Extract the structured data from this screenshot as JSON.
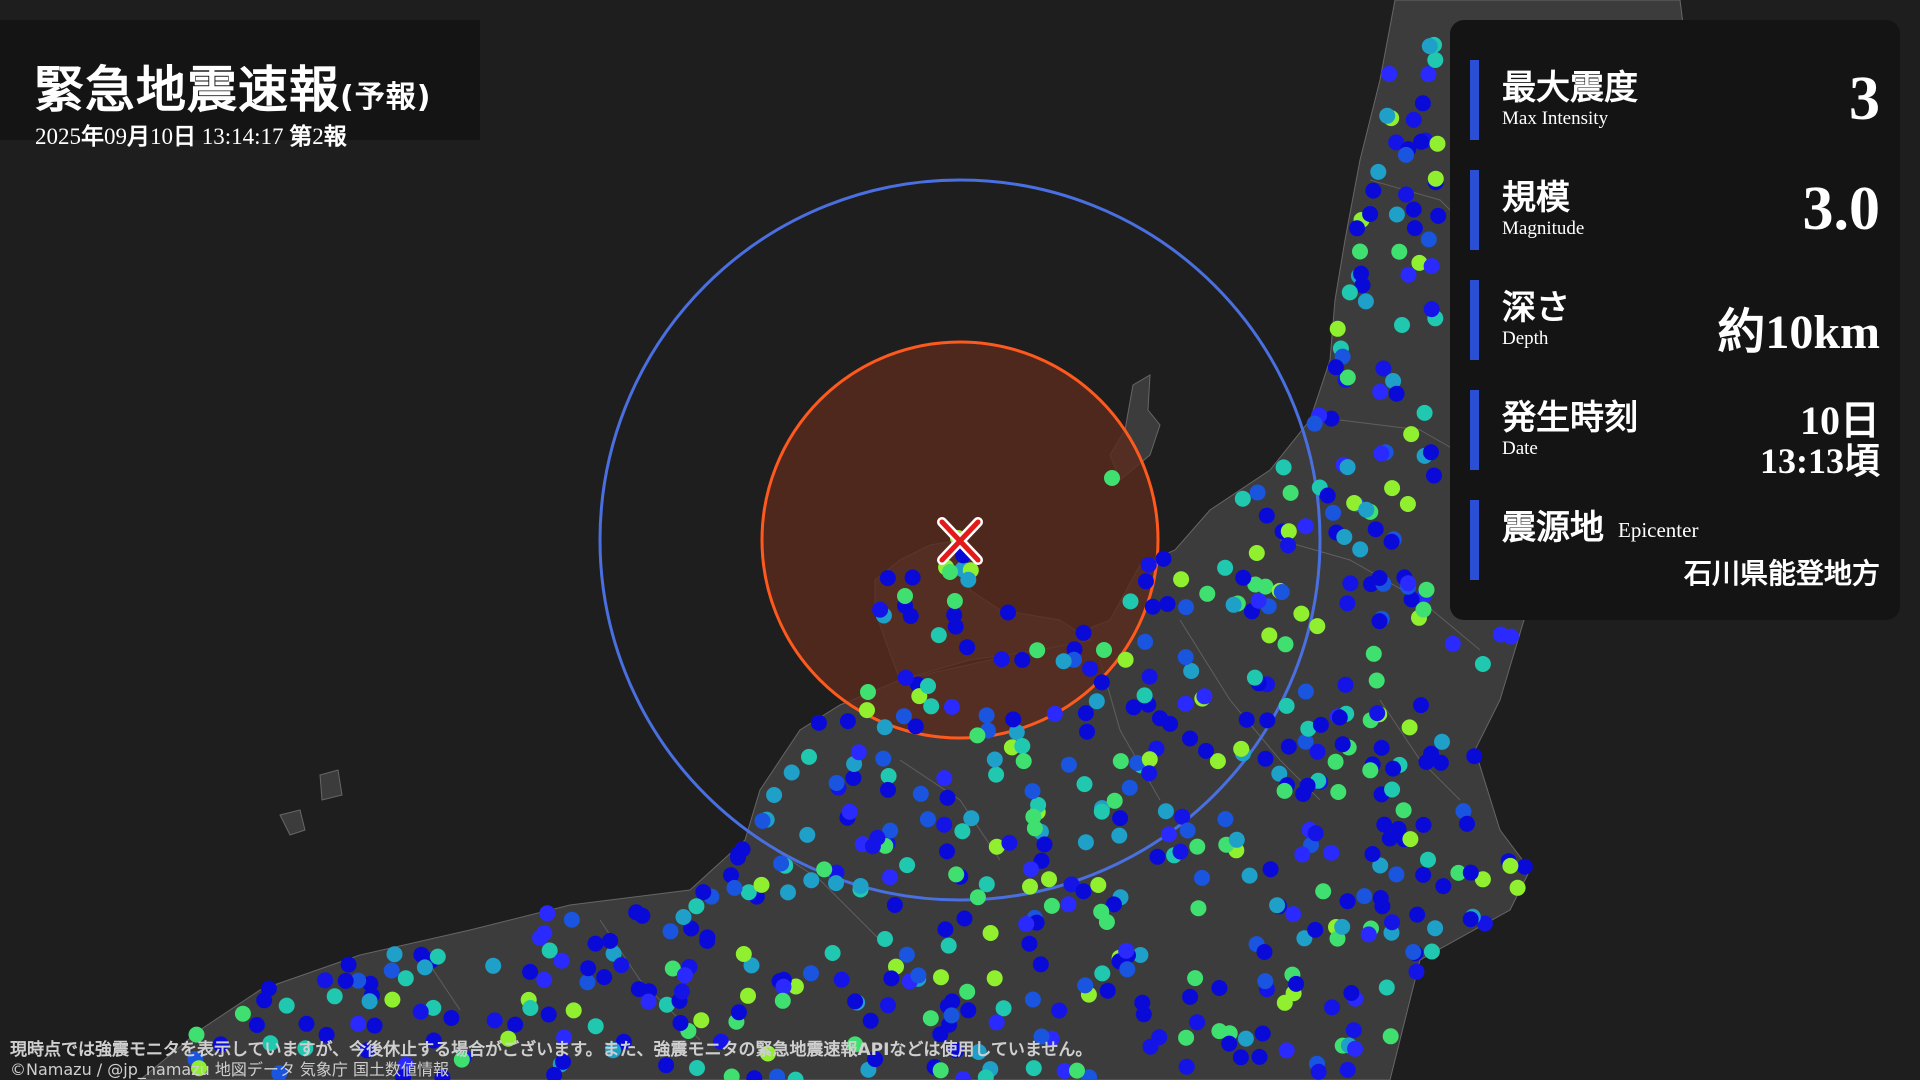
{
  "header": {
    "title": "緊急地震速報",
    "title_sub": "(予報)",
    "date_prefix": "2025",
    "date_year_char": "年",
    "date_month": "09",
    "date_month_char": "月",
    "date_day": "10",
    "date_day_char": "日",
    "time": "13:14:17",
    "report_prefix": "第",
    "report_number": "2",
    "report_suffix": "報"
  },
  "info": {
    "max_intensity": {
      "label": "最大震度",
      "label_en": "Max Intensity",
      "value": "3"
    },
    "magnitude": {
      "label": "規模",
      "label_en": "Magnitude",
      "value": "3.0"
    },
    "depth": {
      "label": "深さ",
      "label_en": "Depth",
      "value": "約10km"
    },
    "date": {
      "label": "発生時刻",
      "label_en": "Date",
      "day": "10日",
      "time": "13:13頃"
    },
    "epicenter": {
      "label": "震源地",
      "label_en": "Epicenter",
      "value": "石川県能登地方"
    }
  },
  "footer": {
    "notice": "現時点では強震モニタを表示していますが、今後休止する場合がございます。また、強震モニタの緊急地震速報APIなどは使用していません。",
    "credit": "©Namazu / @jp_namazu   地図データ 気象庁 国土数値情報"
  },
  "colors": {
    "background": "#1e1e1e",
    "land": "#3c3c3c",
    "panel": "#141414",
    "accent_bar": "#2a4fd4",
    "p_wave_circle": "#4a6fe0",
    "s_wave_circle": "#ff5a1e",
    "s_wave_fill": "#5a2a1c",
    "epicenter_mark": "#e31a1a"
  },
  "icons": {
    "epicenter": "epicenter-x-icon"
  }
}
